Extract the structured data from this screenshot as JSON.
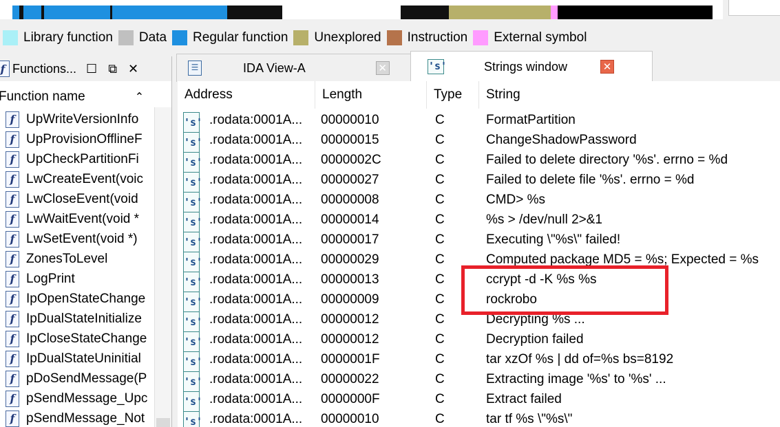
{
  "legend": [
    {
      "label": "Library function",
      "color": "#aaf0f7"
    },
    {
      "label": "Data",
      "color": "#c0c0c0"
    },
    {
      "label": "Regular function",
      "color": "#1e90e0"
    },
    {
      "label": "Unexplored",
      "color": "#b7b06a"
    },
    {
      "label": "Instruction",
      "color": "#b5734b"
    },
    {
      "label": "External symbol",
      "color": "#ff9bff"
    }
  ],
  "functions_panel": {
    "title": "Functions...",
    "column_header": "Function name",
    "items": [
      "UpWriteVersionInfo",
      "UpProvisionOfflineF",
      "UpCheckPartitionFi",
      "LwCreateEvent(voic",
      "LwCloseEvent(void",
      "LwWaitEvent(void *",
      "LwSetEvent(void *)",
      "ZonesToLevel",
      "LogPrint",
      "IpOpenStateChange",
      "IpDualStateInitialize",
      "IpCloseStateChange",
      "IpDualStateUninitial",
      "pDoSendMessage(P",
      "pSendMessage_Upc",
      "pSendMessage_Not"
    ]
  },
  "tabs": [
    {
      "label": "IDA View-A"
    },
    {
      "label": "Strings window"
    }
  ],
  "strings_table": {
    "columns": [
      "Address",
      "Length",
      "Type",
      "String"
    ],
    "rows": [
      {
        "address": ".rodata:0001A...",
        "length": "00000010",
        "type": "C",
        "string": "FormatPartition"
      },
      {
        "address": ".rodata:0001A...",
        "length": "00000015",
        "type": "C",
        "string": "ChangeShadowPassword"
      },
      {
        "address": ".rodata:0001A...",
        "length": "0000002C",
        "type": "C",
        "string": "Failed to delete directory '%s'. errno = %d"
      },
      {
        "address": ".rodata:0001A...",
        "length": "00000027",
        "type": "C",
        "string": "Failed to delete file '%s'. errno = %d"
      },
      {
        "address": ".rodata:0001A...",
        "length": "00000008",
        "type": "C",
        "string": "CMD> %s"
      },
      {
        "address": ".rodata:0001A...",
        "length": "00000014",
        "type": "C",
        "string": "%s > /dev/null 2>&1"
      },
      {
        "address": ".rodata:0001A...",
        "length": "00000017",
        "type": "C",
        "string": "Executing \\\"%s\\\" failed!"
      },
      {
        "address": ".rodata:0001A...",
        "length": "00000029",
        "type": "C",
        "string": "Computed package MD5 = %s; Expected = %s"
      },
      {
        "address": ".rodata:0001A...",
        "length": "00000013",
        "type": "C",
        "string": "ccrypt -d -K %s %s"
      },
      {
        "address": ".rodata:0001A...",
        "length": "00000009",
        "type": "C",
        "string": "rockrobo"
      },
      {
        "address": ".rodata:0001A...",
        "length": "00000012",
        "type": "C",
        "string": "Decrypting %s ..."
      },
      {
        "address": ".rodata:0001A...",
        "length": "00000012",
        "type": "C",
        "string": "Decryption failed"
      },
      {
        "address": ".rodata:0001A...",
        "length": "0000001F",
        "type": "C",
        "string": "tar xzOf %s | dd of=%s bs=8192"
      },
      {
        "address": ".rodata:0001A...",
        "length": "00000022",
        "type": "C",
        "string": "Extracting image '%s' to '%s' ..."
      },
      {
        "address": ".rodata:0001A...",
        "length": "0000000F",
        "type": "C",
        "string": "Extract failed"
      },
      {
        "address": ".rodata:0001A...",
        "length": "00000010",
        "type": "C",
        "string": "tar tf %s \\\"%s\\\""
      }
    ]
  }
}
